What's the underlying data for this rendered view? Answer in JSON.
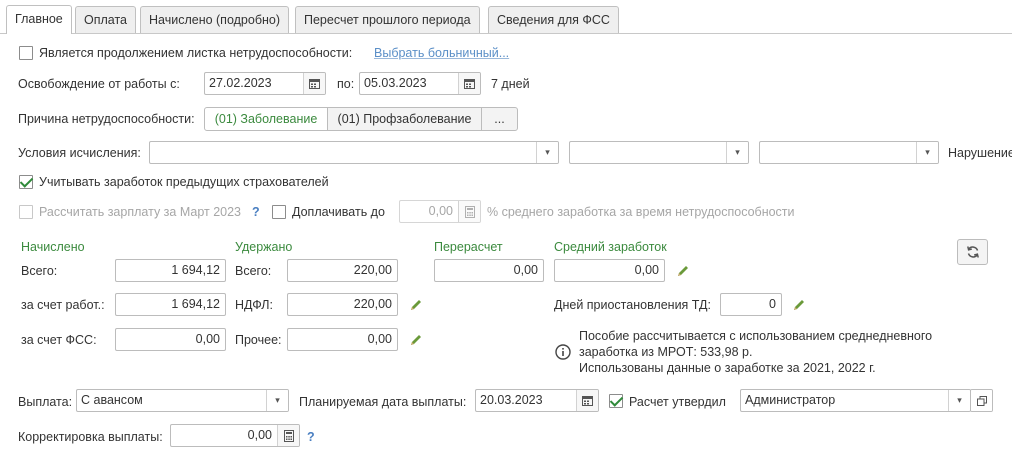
{
  "tabs": [
    "Главное",
    "Оплата",
    "Начислено (подробно)",
    "Пересчет прошлого периода",
    "Сведения для ФСС"
  ],
  "continuation": {
    "label": "Является продолжением листка нетрудоспособности:",
    "link": "Выбрать больничный..."
  },
  "release": {
    "label": "Освобождение от работы с:",
    "from": "27.02.2023",
    "to_label": "по:",
    "to": "05.03.2023",
    "days": "7 дней"
  },
  "reason": {
    "label": "Причина нетрудоспособности:",
    "options": [
      "(01) Заболевание",
      "(01) Профзаболевание"
    ],
    "more": "..."
  },
  "conditions": {
    "label": "Условия исчисления:",
    "value1": "",
    "value2": "",
    "value3": "",
    "violation_label": "Нарушение"
  },
  "prev_insurers": {
    "label": "Учитывать заработок предыдущих страхователей"
  },
  "salary_calc": {
    "label": "Рассчитать зарплату за Март 2023",
    "help": "?",
    "extra_label": "Доплачивать до",
    "extra_value": "0,00",
    "extra_suffix": "% среднего заработка за время нетрудоспособности"
  },
  "accrued": {
    "title": "Начислено",
    "total_label": "Всего:",
    "total": "1 694,12",
    "employer_label": "за счет работ.:",
    "employer": "1 694,12",
    "fss_label": "за счет ФСС:",
    "fss": "0,00"
  },
  "withheld": {
    "title": "Удержано",
    "total_label": "Всего:",
    "total": "220,00",
    "ndfl_label": "НДФЛ:",
    "ndfl": "220,00",
    "other_label": "Прочее:",
    "other": "0,00"
  },
  "recalc": {
    "title": "Перерасчет",
    "value": "0,00"
  },
  "avg": {
    "title": "Средний заработок",
    "value": "0,00",
    "suspension_label": "Дней приостановления ТД:",
    "suspension": "0",
    "info_lines": [
      "Пособие рассчитывается с использованием среднедневного",
      "заработка из МРОТ: 533,98 р.",
      "Использованы данные о заработке за  2021,  2022 г."
    ]
  },
  "payment": {
    "label": "Выплата:",
    "value": "С авансом",
    "planned_label": "Планируемая дата выплаты:",
    "planned_date": "20.03.2023",
    "approved_label": "Расчет утвердил",
    "approver": "Администратор"
  },
  "correction": {
    "label": "Корректировка выплаты:",
    "value": "0,00",
    "help": "?"
  },
  "colors": {
    "accent_green": "#3b8a3e",
    "link_blue": "#5b8fc7",
    "help_blue": "#4a7fc1"
  }
}
